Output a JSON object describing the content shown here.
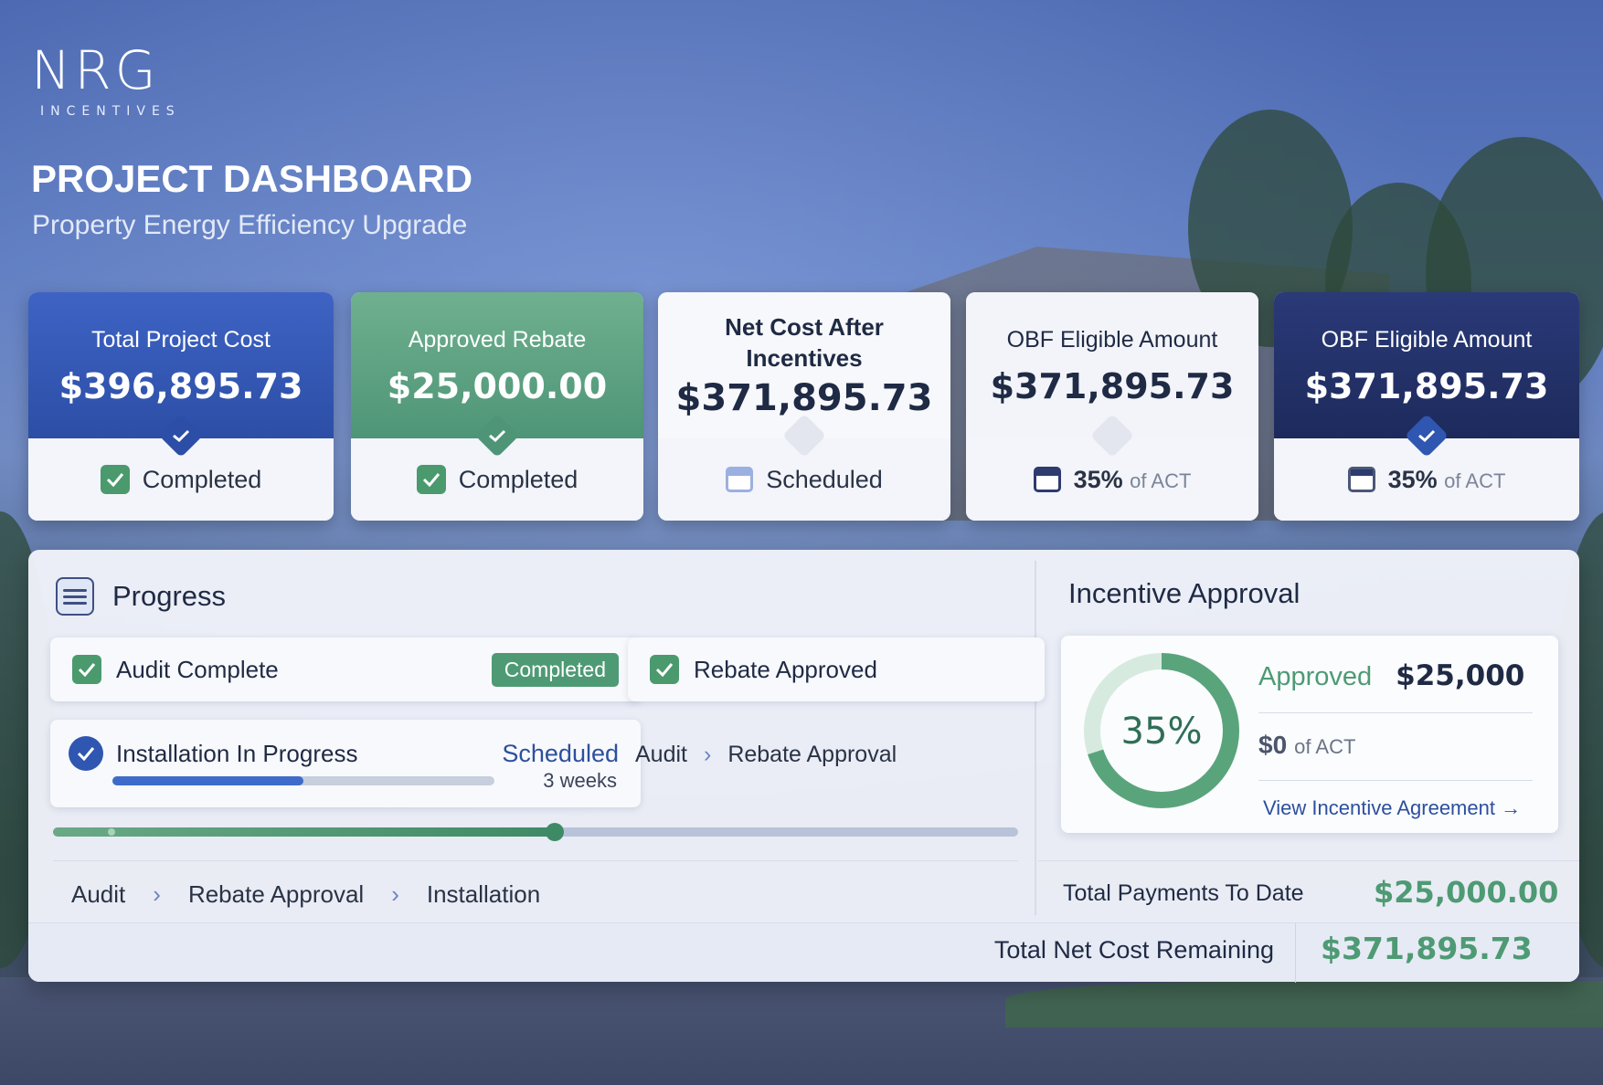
{
  "brand": {
    "logo_text": "NRG",
    "logo_sub": "INCENTIVES"
  },
  "header": {
    "title": "PROJECT DASHBOARD",
    "subtitle": "Property Energy Efficiency Upgrade"
  },
  "kpis": [
    {
      "label": "Total Project Cost",
      "value": "$396,895.73",
      "status": "Completed",
      "status_icon": "check-icon"
    },
    {
      "label": "Approved Rebate",
      "value": "$25,000.00",
      "status": "Completed",
      "status_icon": "check-icon"
    },
    {
      "label": "Net Cost After Incentives",
      "value": "$371,895.73",
      "status": "Scheduled",
      "status_icon": "calendar-icon"
    },
    {
      "label": "OBF Eligible Amount",
      "value": "$371,895.73",
      "status_strong": "35%",
      "status_suffix": "of ACT",
      "status_icon": "calendar-icon"
    },
    {
      "label": "OBF Eligible Amount",
      "value": "$371,895.73",
      "status_strong": "35%",
      "status_suffix": "of ACT",
      "status_icon": "calendar-icon"
    }
  ],
  "progress": {
    "title": "Progress",
    "steps": {
      "audit": {
        "label": "Audit Complete",
        "badge": "Completed"
      },
      "rebate": {
        "label": "Rebate Approved"
      },
      "installation": {
        "label": "Installation In Progress",
        "status": "Scheduled",
        "duration": "3 weeks",
        "fraction": 0.5
      }
    },
    "mini_breadcrumb": [
      "Audit",
      "Rebate Approval"
    ],
    "overall_fraction": 0.52,
    "breadcrumb": [
      "Audit",
      "Rebate Approval",
      "Installation"
    ]
  },
  "incentive": {
    "title": "Incentive Approval",
    "percent_label": "35%",
    "percent": 35,
    "approved_label": "Approved",
    "approved_amount": "$25,000",
    "zero_amount": "$0",
    "zero_suffix": "of ACT",
    "link": "View Incentive Agreement →"
  },
  "totals": {
    "payments_label": "Total Payments To Date",
    "payments_value": "$25,000.00",
    "remaining_label": "Total Net Cost Remaining",
    "remaining_value": "$371,895.73"
  },
  "colors": {
    "primary_blue": "#2c4ea6",
    "green": "#4e9a74",
    "navy": "#1d2a5c"
  }
}
